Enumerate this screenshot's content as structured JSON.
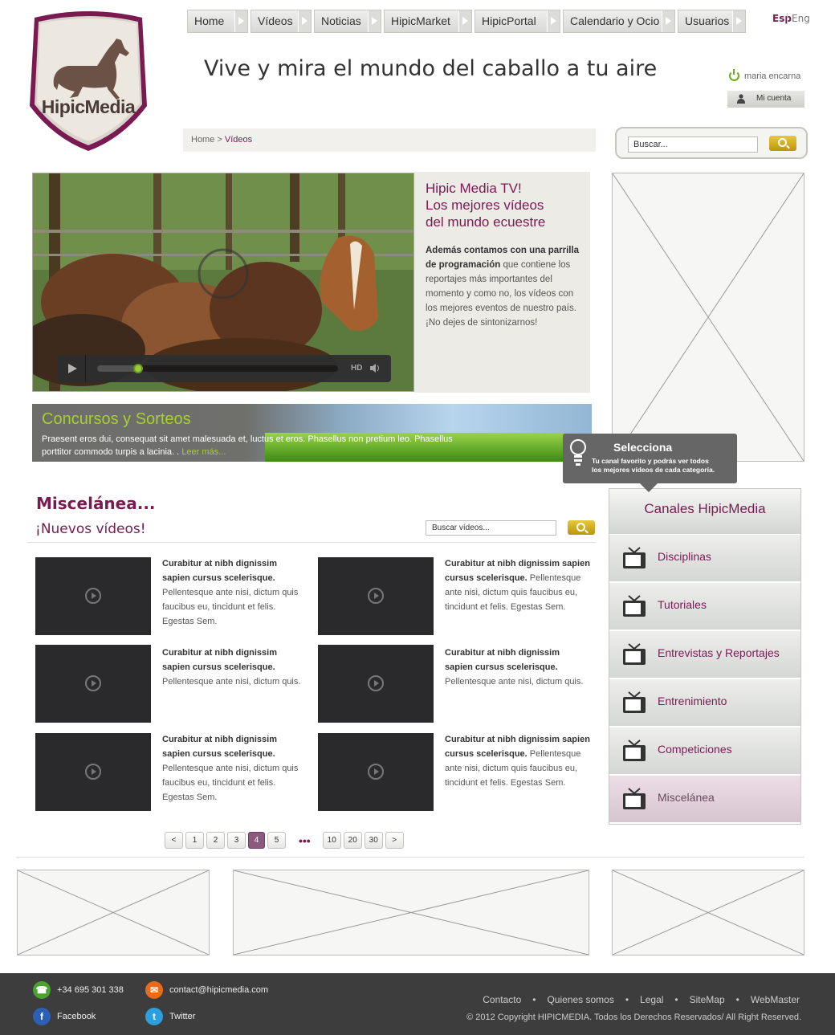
{
  "brand": {
    "logo_text": "HipicMedia"
  },
  "nav": [
    "Home",
    "Vídeos",
    "Noticias",
    "HipicMarket",
    "HipicPortal",
    "Calendario y Ocio",
    "Usuarios"
  ],
  "lang": {
    "esp": "Esp",
    "eng": "Eng"
  },
  "tagline": "Vive y mira el mundo del caballo a tu aire",
  "user": {
    "name": "maria encarna",
    "account": "Mi cuenta"
  },
  "breadcrumb": {
    "home": "Home",
    "sep": ">",
    "current": "Vídeos"
  },
  "search": {
    "value": "Buscar..."
  },
  "player": {
    "hd": "HD",
    "progress": 0.17
  },
  "tv": {
    "title1": "Hipic Media TV!",
    "title2": "Los mejores vídeos",
    "title3": "del mundo ecuestre",
    "bold": "Además contamos con una parrilla de programación",
    "body": " que contiene los reportajes más importantes del momento y como no, los vídeos con los mejores eventos de nuestro país.",
    "cta": "¡No dejes de sintonizarnos!"
  },
  "concursos": {
    "title": "Concursos y Sorteos",
    "text": "Praesent eros dui, consequat sit amet malesuada et, luctus et eros. Phasellus non pretium leo. Phasellus porttitor commodo turpis a lacinia. . ",
    "more": "Leer más..."
  },
  "tooltip": {
    "title": "Selecciona",
    "line1": "Tu canal favorito y podrás ver todos",
    "line2": "los mejores vídeos de cada categoría."
  },
  "misc": {
    "title": "Miscelánea...",
    "subtitle": "¡Nuevos vídeos!",
    "search_value": "Buscar vídeos..."
  },
  "videos": [
    {
      "bold": "Curabitur at nibh dignissim sapien cursus scelerisque.",
      "text": " Pellentesque ante nisi, dictum quis faucibus eu, tincidunt et felis. Egestas Sem."
    },
    {
      "bold": "Curabitur at nibh dignissim sapien cursus scelerisque.",
      "text": " Pellentesque ante nisi, dictum quis faucibus eu, tincidunt et felis. Egestas Sem."
    },
    {
      "bold": "Curabitur at nibh dignissim sapien cursus scelerisque.",
      "text": " Pellentesque ante nisi, dictum quis."
    },
    {
      "bold": "Curabitur at nibh dignissim sapien cursus scelerisque.",
      "text": " Pellentesque ante nisi, dictum quis."
    },
    {
      "bold": "Curabitur at nibh dignissim sapien cursus scelerisque.",
      "text": " Pellentesque ante nisi, dictum quis faucibus eu, tincidunt et felis. Egestas Sem."
    },
    {
      "bold": "Curabitur at nibh dignissim sapien cursus scelerisque.",
      "text": " Pellentesque ante nisi, dictum quis faucibus eu, tincidunt et felis. Egestas Sem."
    }
  ],
  "pager": {
    "prev": "<",
    "pages_a": [
      "1",
      "2",
      "3",
      "4",
      "5"
    ],
    "current": "4",
    "dots": "•••",
    "pages_b": [
      "10",
      "20",
      "30"
    ],
    "next": ">"
  },
  "canales": {
    "title": "Canales HipicMedia",
    "items": [
      "Disciplinas",
      "Tutoriales",
      "Entrevistas y Reportajes",
      "Entrenimiento",
      "Competiciones",
      "Miscelánea"
    ],
    "active": "Miscelánea"
  },
  "footer": {
    "phone": "+34 695 301 338",
    "email": "contact@hipicmedia.com",
    "facebook": "Facebook",
    "twitter": "Twitter",
    "links": [
      "Contacto",
      "Quienes somos",
      "Legal",
      "SiteMap",
      "WebMaster"
    ],
    "link_sep": "•",
    "copyright": "© 2012 Copyright HIPICMEDIA. Todos los Derechos Reservados/ All Right Reserved."
  },
  "colors": {
    "brand": "#7a1a52",
    "accent_green": "#a7d02a",
    "gold": "#d4b326",
    "footer_bg": "#3e3d3d"
  }
}
